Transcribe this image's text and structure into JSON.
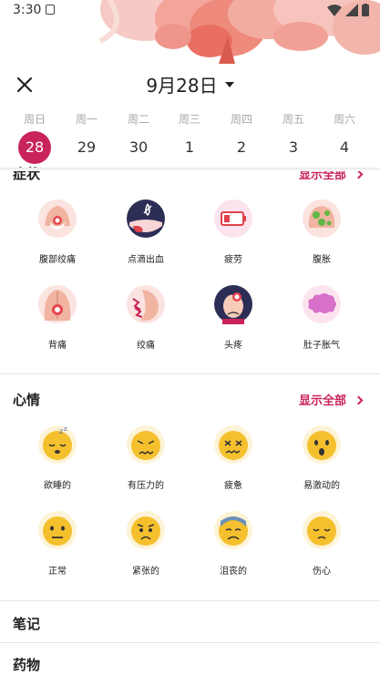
{
  "status_bar": {
    "time": "3:30"
  },
  "header": {
    "date_label": "9月28日"
  },
  "week": [
    {
      "name": "周日",
      "num": "28",
      "selected": true
    },
    {
      "name": "周一",
      "num": "29"
    },
    {
      "name": "周二",
      "num": "30"
    },
    {
      "name": "周三",
      "num": "1"
    },
    {
      "name": "周四",
      "num": "2"
    },
    {
      "name": "周五",
      "num": "3"
    },
    {
      "name": "周六",
      "num": "4"
    }
  ],
  "symptoms": {
    "title": "症状",
    "show_all": "显示全部",
    "items": [
      {
        "label": "腹部绞痛",
        "icon": "abdominal-cramps-icon"
      },
      {
        "label": "点滴出血",
        "icon": "spotting-icon"
      },
      {
        "label": "疲劳",
        "icon": "low-battery-icon"
      },
      {
        "label": "腹胀",
        "icon": "bloating-icon"
      },
      {
        "label": "背痛",
        "icon": "back-pain-icon"
      },
      {
        "label": "绞痛",
        "icon": "cramps-icon"
      },
      {
        "label": "头疼",
        "icon": "headache-icon"
      },
      {
        "label": "肚子胀气",
        "icon": "gas-icon"
      }
    ]
  },
  "mood": {
    "title": "心情",
    "show_all": "显示全部",
    "items": [
      {
        "label": "欲睡的",
        "icon": "sleepy-face-icon"
      },
      {
        "label": "有压力的",
        "icon": "stressed-face-icon"
      },
      {
        "label": "疲惫",
        "icon": "exhausted-face-icon"
      },
      {
        "label": "易激动的",
        "icon": "excited-face-icon"
      },
      {
        "label": "正常",
        "icon": "neutral-face-icon"
      },
      {
        "label": "紧张的",
        "icon": "nervous-face-icon"
      },
      {
        "label": "沮丧的",
        "icon": "depressed-face-icon"
      },
      {
        "label": "伤心",
        "icon": "sad-face-icon"
      }
    ]
  },
  "notes": {
    "title": "笔记"
  },
  "medicine": {
    "title": "药物"
  },
  "colors": {
    "accent": "#c8245a",
    "emoji": "#f5c02d"
  }
}
